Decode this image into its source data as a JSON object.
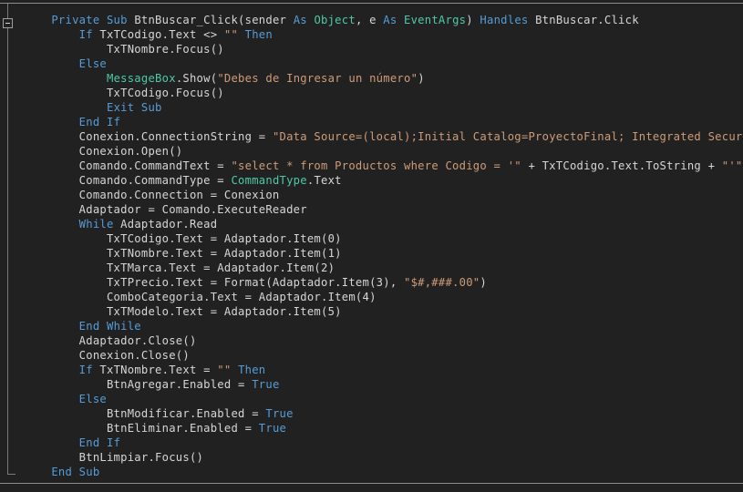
{
  "editor": {
    "app": "code-editor",
    "language": "VB.NET",
    "theme": "dark",
    "colors": {
      "background": "#212121",
      "foreground": "#d6d6d6",
      "keyword": "#569cd6",
      "type": "#4ec9a6",
      "string": "#ce9b79",
      "gutter_line": "#7a7a7a",
      "edge_rule": "#8e8e8e"
    },
    "gutter": {
      "fold_marker_label": "-",
      "fold_marker_state": "expanded"
    }
  },
  "code": {
    "lines": [
      [
        {
          "t": "    ",
          "c": "pln"
        },
        {
          "t": "Private Sub ",
          "c": "kw"
        },
        {
          "t": "BtnBuscar_Click(sender ",
          "c": "pln"
        },
        {
          "t": "As ",
          "c": "kw"
        },
        {
          "t": "Object",
          "c": "typ"
        },
        {
          "t": ", e ",
          "c": "pln"
        },
        {
          "t": "As ",
          "c": "kw"
        },
        {
          "t": "EventArgs",
          "c": "typ"
        },
        {
          "t": ") ",
          "c": "pln"
        },
        {
          "t": "Handles ",
          "c": "kw"
        },
        {
          "t": "BtnBuscar.Click",
          "c": "pln"
        }
      ],
      [
        {
          "t": "        ",
          "c": "pln"
        },
        {
          "t": "If ",
          "c": "kw"
        },
        {
          "t": "TxTCodigo.Text <> ",
          "c": "pln"
        },
        {
          "t": "\"\"",
          "c": "str"
        },
        {
          "t": " ",
          "c": "pln"
        },
        {
          "t": "Then",
          "c": "kw"
        }
      ],
      [
        {
          "t": "            TxTNombre.Focus()",
          "c": "pln"
        }
      ],
      [
        {
          "t": "        ",
          "c": "pln"
        },
        {
          "t": "Else",
          "c": "kw"
        }
      ],
      [
        {
          "t": "            ",
          "c": "pln"
        },
        {
          "t": "MessageBox",
          "c": "typ"
        },
        {
          "t": ".Show(",
          "c": "pln"
        },
        {
          "t": "\"Debes de Ingresar un número\"",
          "c": "str"
        },
        {
          "t": ")",
          "c": "pln"
        }
      ],
      [
        {
          "t": "            TxTCodigo.Focus()",
          "c": "pln"
        }
      ],
      [
        {
          "t": "            ",
          "c": "pln"
        },
        {
          "t": "Exit Sub",
          "c": "kw"
        }
      ],
      [
        {
          "t": "        ",
          "c": "pln"
        },
        {
          "t": "End If",
          "c": "kw"
        }
      ],
      [
        {
          "t": "        Conexion.ConnectionString = ",
          "c": "pln"
        },
        {
          "t": "\"Data Source=(local);Initial Catalog=ProyectoFinal; Integrated Security=SSPI\"",
          "c": "str"
        }
      ],
      [
        {
          "t": "        Conexion.Open()",
          "c": "pln"
        }
      ],
      [
        {
          "t": "        Comando.CommandText = ",
          "c": "pln"
        },
        {
          "t": "\"select * from Productos where Codigo = '\"",
          "c": "str"
        },
        {
          "t": " + TxTCodigo.Text.ToString + ",
          "c": "pln"
        },
        {
          "t": "\"'\"",
          "c": "str"
        }
      ],
      [
        {
          "t": "        Comando.CommandType = ",
          "c": "pln"
        },
        {
          "t": "CommandType",
          "c": "typ"
        },
        {
          "t": ".Text",
          "c": "pln"
        }
      ],
      [
        {
          "t": "        Comando.Connection = Conexion",
          "c": "pln"
        }
      ],
      [
        {
          "t": "        Adaptador = Comando.ExecuteReader",
          "c": "pln"
        }
      ],
      [
        {
          "t": "        ",
          "c": "pln"
        },
        {
          "t": "While ",
          "c": "kw"
        },
        {
          "t": "Adaptador.Read",
          "c": "pln"
        }
      ],
      [
        {
          "t": "            TxTCodigo.Text = Adaptador.Item(0)",
          "c": "pln"
        }
      ],
      [
        {
          "t": "            TxTNombre.Text = Adaptador.Item(1)",
          "c": "pln"
        }
      ],
      [
        {
          "t": "            TxTMarca.Text = Adaptador.Item(2)",
          "c": "pln"
        }
      ],
      [
        {
          "t": "            TxTPrecio.Text = Format(Adaptador.Item(3), ",
          "c": "pln"
        },
        {
          "t": "\"$#,###.00\"",
          "c": "str"
        },
        {
          "t": ")",
          "c": "pln"
        }
      ],
      [
        {
          "t": "            ComboCategoria.Text = Adaptador.Item(4)",
          "c": "pln"
        }
      ],
      [
        {
          "t": "            TxTModelo.Text = Adaptador.Item(5)",
          "c": "pln"
        }
      ],
      [
        {
          "t": "        ",
          "c": "pln"
        },
        {
          "t": "End While",
          "c": "kw"
        }
      ],
      [
        {
          "t": "        Adaptador.Close()",
          "c": "pln"
        }
      ],
      [
        {
          "t": "        Conexion.Close()",
          "c": "pln"
        }
      ],
      [
        {
          "t": "        ",
          "c": "pln"
        },
        {
          "t": "If ",
          "c": "kw"
        },
        {
          "t": "TxTNombre.Text = ",
          "c": "pln"
        },
        {
          "t": "\"\"",
          "c": "str"
        },
        {
          "t": " ",
          "c": "pln"
        },
        {
          "t": "Then",
          "c": "kw"
        }
      ],
      [
        {
          "t": "            BtnAgregar.Enabled = ",
          "c": "pln"
        },
        {
          "t": "True",
          "c": "kw"
        }
      ],
      [
        {
          "t": "        ",
          "c": "pln"
        },
        {
          "t": "Else",
          "c": "kw"
        }
      ],
      [
        {
          "t": "            BtnModificar.Enabled = ",
          "c": "pln"
        },
        {
          "t": "True",
          "c": "kw"
        }
      ],
      [
        {
          "t": "            BtnEliminar.Enabled = ",
          "c": "pln"
        },
        {
          "t": "True",
          "c": "kw"
        }
      ],
      [
        {
          "t": "        ",
          "c": "pln"
        },
        {
          "t": "End If",
          "c": "kw"
        }
      ],
      [
        {
          "t": "        BtnLimpiar.Focus()",
          "c": "pln"
        }
      ],
      [
        {
          "t": "    ",
          "c": "pln"
        },
        {
          "t": "End Sub",
          "c": "kw"
        }
      ]
    ]
  }
}
